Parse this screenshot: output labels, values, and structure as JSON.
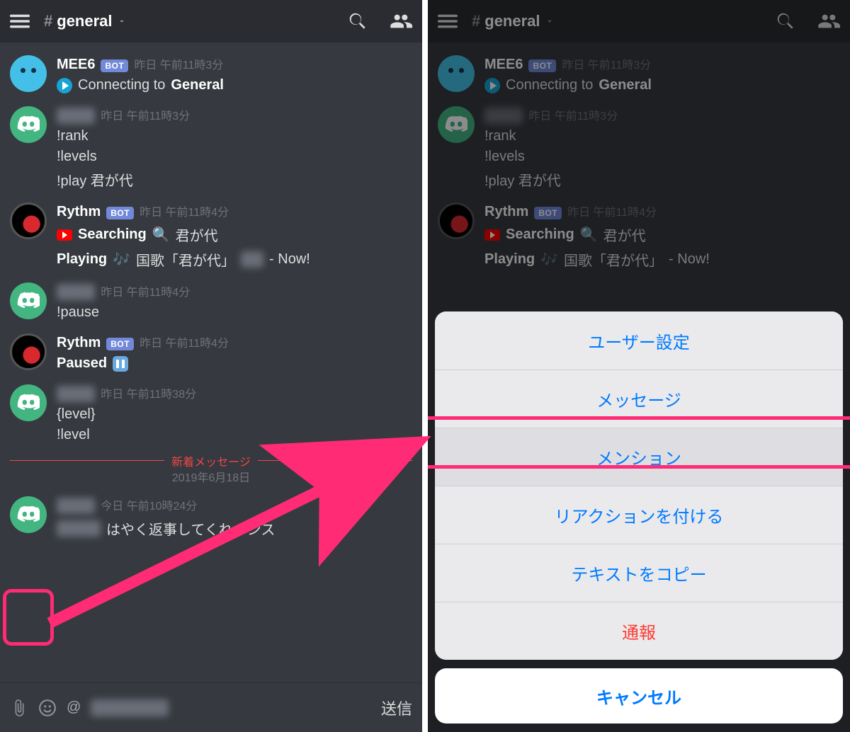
{
  "header": {
    "hash": "#",
    "channel_name": "general"
  },
  "bot_tag": "BOT",
  "left": {
    "m1": {
      "name": "MEE6",
      "ts": "昨日 午前11時3分",
      "connecting_prefix": "Connecting to",
      "connecting_bold": "General"
    },
    "m2": {
      "ts": "昨日 午前11時3分",
      "l1": "!rank",
      "l2": "!levels",
      "l3": "!play 君が代"
    },
    "m3": {
      "name": "Rythm",
      "ts": "昨日 午前11時4分",
      "search_bold": "Searching",
      "search_tail": "君が代",
      "playing_bold": "Playing",
      "playing_mid": "国歌「君が代」",
      "playing_tail": "- Now!"
    },
    "m4": {
      "ts": "昨日 午前11時4分",
      "l1": "!pause"
    },
    "m5": {
      "name": "Rythm",
      "ts": "昨日 午前11時4分",
      "paused_bold": "Paused"
    },
    "m6": {
      "ts": "昨日 午前11時38分",
      "l1": "{level}",
      "l2": "!level"
    },
    "new_divider": "新着メッセージ",
    "date_divider": "2019年6月18日",
    "m7": {
      "ts": "今日 午前10時24分",
      "body": "はやく返事してくれメンス"
    },
    "input": {
      "mention": "@",
      "send": "送信"
    }
  },
  "right": {
    "m1": {
      "name": "MEE6",
      "ts": "昨日 午前11時3分",
      "connecting_prefix": "Connecting to",
      "connecting_bold": "General"
    },
    "m2": {
      "ts": "昨日 午前11時3分",
      "l1": "!rank",
      "l2": "!levels",
      "l3": "!play 君が代"
    },
    "m3": {
      "name": "Rythm",
      "ts": "昨日 午前11時4分",
      "search_bold": "Searching",
      "search_tail": "君が代",
      "playing_bold": "Playing",
      "playing_mid": "国歌「君が代」",
      "playing_tail": "- Now!"
    }
  },
  "sheet": {
    "user_settings": "ユーザー設定",
    "message": "メッセージ",
    "mention": "メンション",
    "reaction": "リアクションを付ける",
    "copy_text": "テキストをコピー",
    "report": "通報",
    "cancel": "キャンセル"
  }
}
